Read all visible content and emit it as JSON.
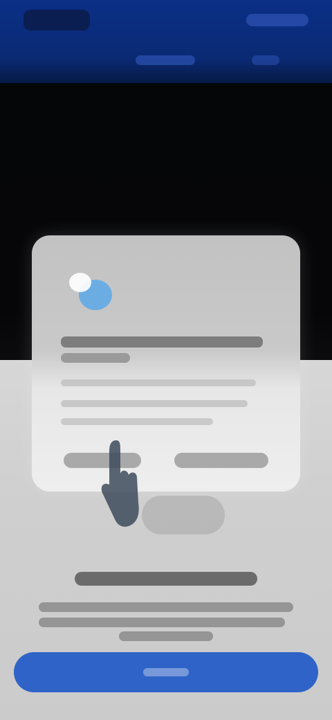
{
  "colors": {
    "header_bg": "#0a2f86",
    "video_bg": "#050608",
    "page_bg": "#cfcfcf",
    "primary_button": "#2f63c7",
    "card_bg": "#e7e7e7",
    "badge_blue": "#5aa8e8"
  },
  "header": {
    "logo_icon": "brand-logo",
    "action_icon": "header-action"
  },
  "illustration": {
    "badge_icon": "chat-bubble-icon",
    "cursor_icon": "pointer-hand-icon"
  },
  "primary_button": {
    "label": ""
  }
}
